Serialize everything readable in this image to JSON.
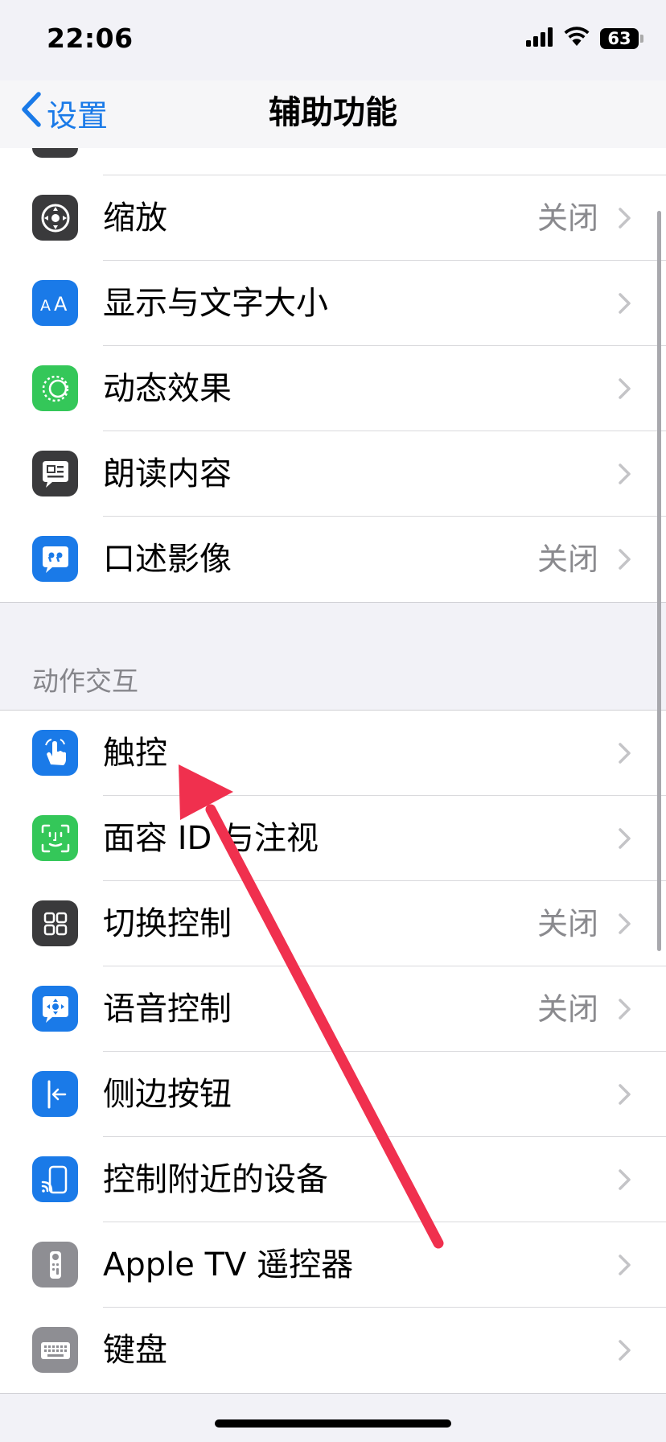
{
  "status_bar": {
    "time": "22:06",
    "battery": "63",
    "icons": [
      "cellular-signal-icon",
      "wifi-icon",
      "battery-icon"
    ]
  },
  "nav": {
    "back_label": "设置",
    "title": "辅助功能"
  },
  "section_vision": {
    "rows": [
      {
        "label": "缩放",
        "value": "关闭",
        "icon": "zoom-icon",
        "color": "#3a3a3c"
      },
      {
        "label": "显示与文字大小",
        "value": "",
        "icon": "text-size-icon",
        "color": "#1a7ae8"
      },
      {
        "label": "动态效果",
        "value": "",
        "icon": "motion-icon",
        "color": "#34c759"
      },
      {
        "label": "朗读内容",
        "value": "",
        "icon": "spoken-content-icon",
        "color": "#3a3a3c"
      },
      {
        "label": "口述影像",
        "value": "关闭",
        "icon": "audio-description-icon",
        "color": "#1a7ae8"
      }
    ]
  },
  "section_interaction": {
    "header": "动作交互",
    "rows": [
      {
        "label": "触控",
        "value": "",
        "icon": "touch-icon",
        "color": "#1a7ae8"
      },
      {
        "label": "面容 ID 与注视",
        "value": "",
        "icon": "face-id-icon",
        "color": "#34c759"
      },
      {
        "label": "切换控制",
        "value": "关闭",
        "icon": "switch-control-icon",
        "color": "#3a3a3c"
      },
      {
        "label": "语音控制",
        "value": "关闭",
        "icon": "voice-control-icon",
        "color": "#1a7ae8"
      },
      {
        "label": "侧边按钮",
        "value": "",
        "icon": "side-button-icon",
        "color": "#1a7ae8"
      },
      {
        "label": "控制附近的设备",
        "value": "",
        "icon": "nearby-devices-icon",
        "color": "#1a7ae8"
      },
      {
        "label": "Apple TV 遥控器",
        "value": "",
        "icon": "apple-tv-remote-icon",
        "color": "#8e8e93"
      },
      {
        "label": "键盘",
        "value": "",
        "icon": "keyboard-icon",
        "color": "#8e8e93"
      }
    ]
  },
  "colors": {
    "accent": "#1a7ae8",
    "annotation_arrow": "#f0304e",
    "background": "#f2f2f7"
  }
}
